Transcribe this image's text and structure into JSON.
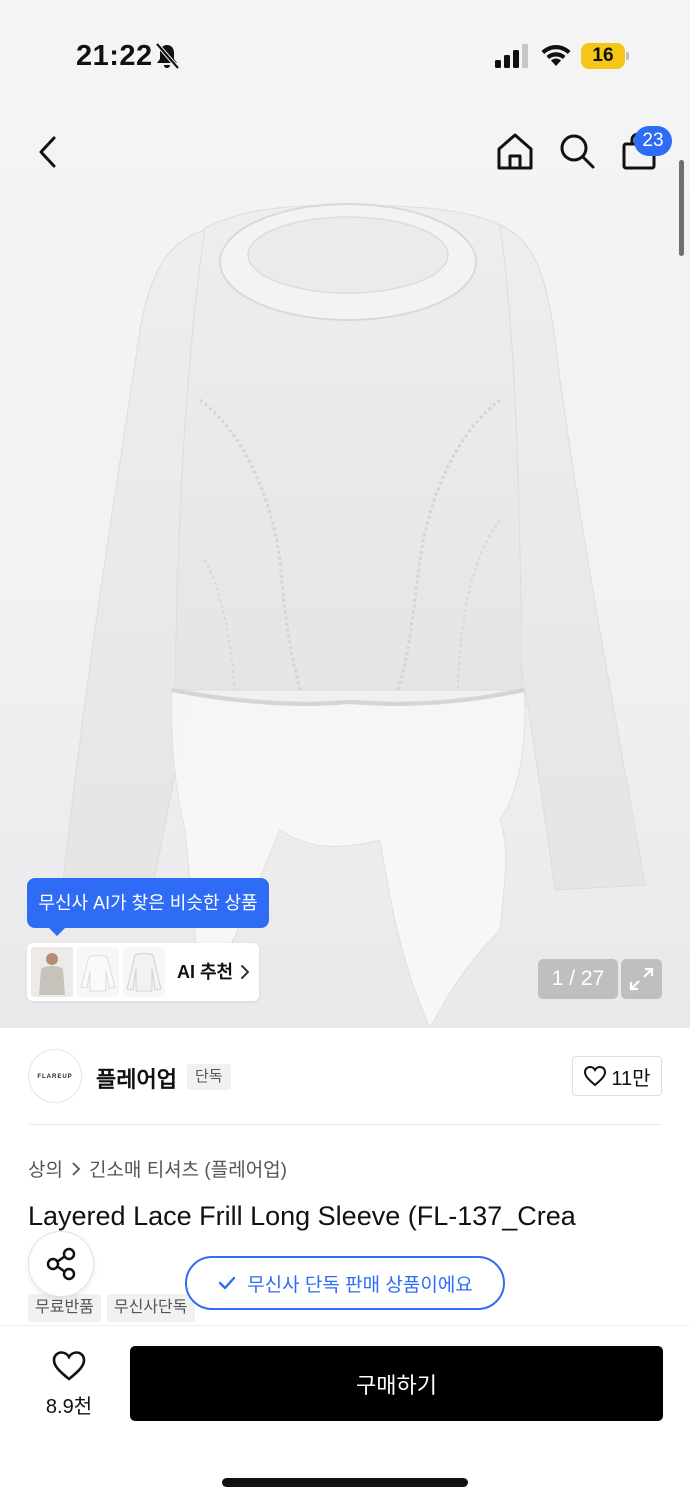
{
  "status_bar": {
    "time": "21:22",
    "battery": "16"
  },
  "nav": {
    "cart_count": "23"
  },
  "gallery": {
    "counter": "1 / 27",
    "ai_tooltip": "무신사 AI가 찾은 비슷한 상품",
    "ai_button_label": "AI 추천"
  },
  "brand": {
    "logo_text": "FLAREUP",
    "name": "플레어업",
    "tag": "단독",
    "like_count": "11만"
  },
  "product": {
    "breadcrumb": [
      "상의",
      "긴소매 티셔츠 (플레어업)"
    ],
    "title": "Layered Lace Frill Long Sleeve (FL-137_Crea",
    "exclusive_notice": "무신사 단독 판매 상품이에요",
    "tags": [
      "무료반품",
      "무신사단독"
    ]
  },
  "bottom": {
    "wish_count": "8.9천",
    "buy_label": "구매하기"
  },
  "colors": {
    "accent": "#2f6cf6",
    "buy_button": "#000000"
  }
}
